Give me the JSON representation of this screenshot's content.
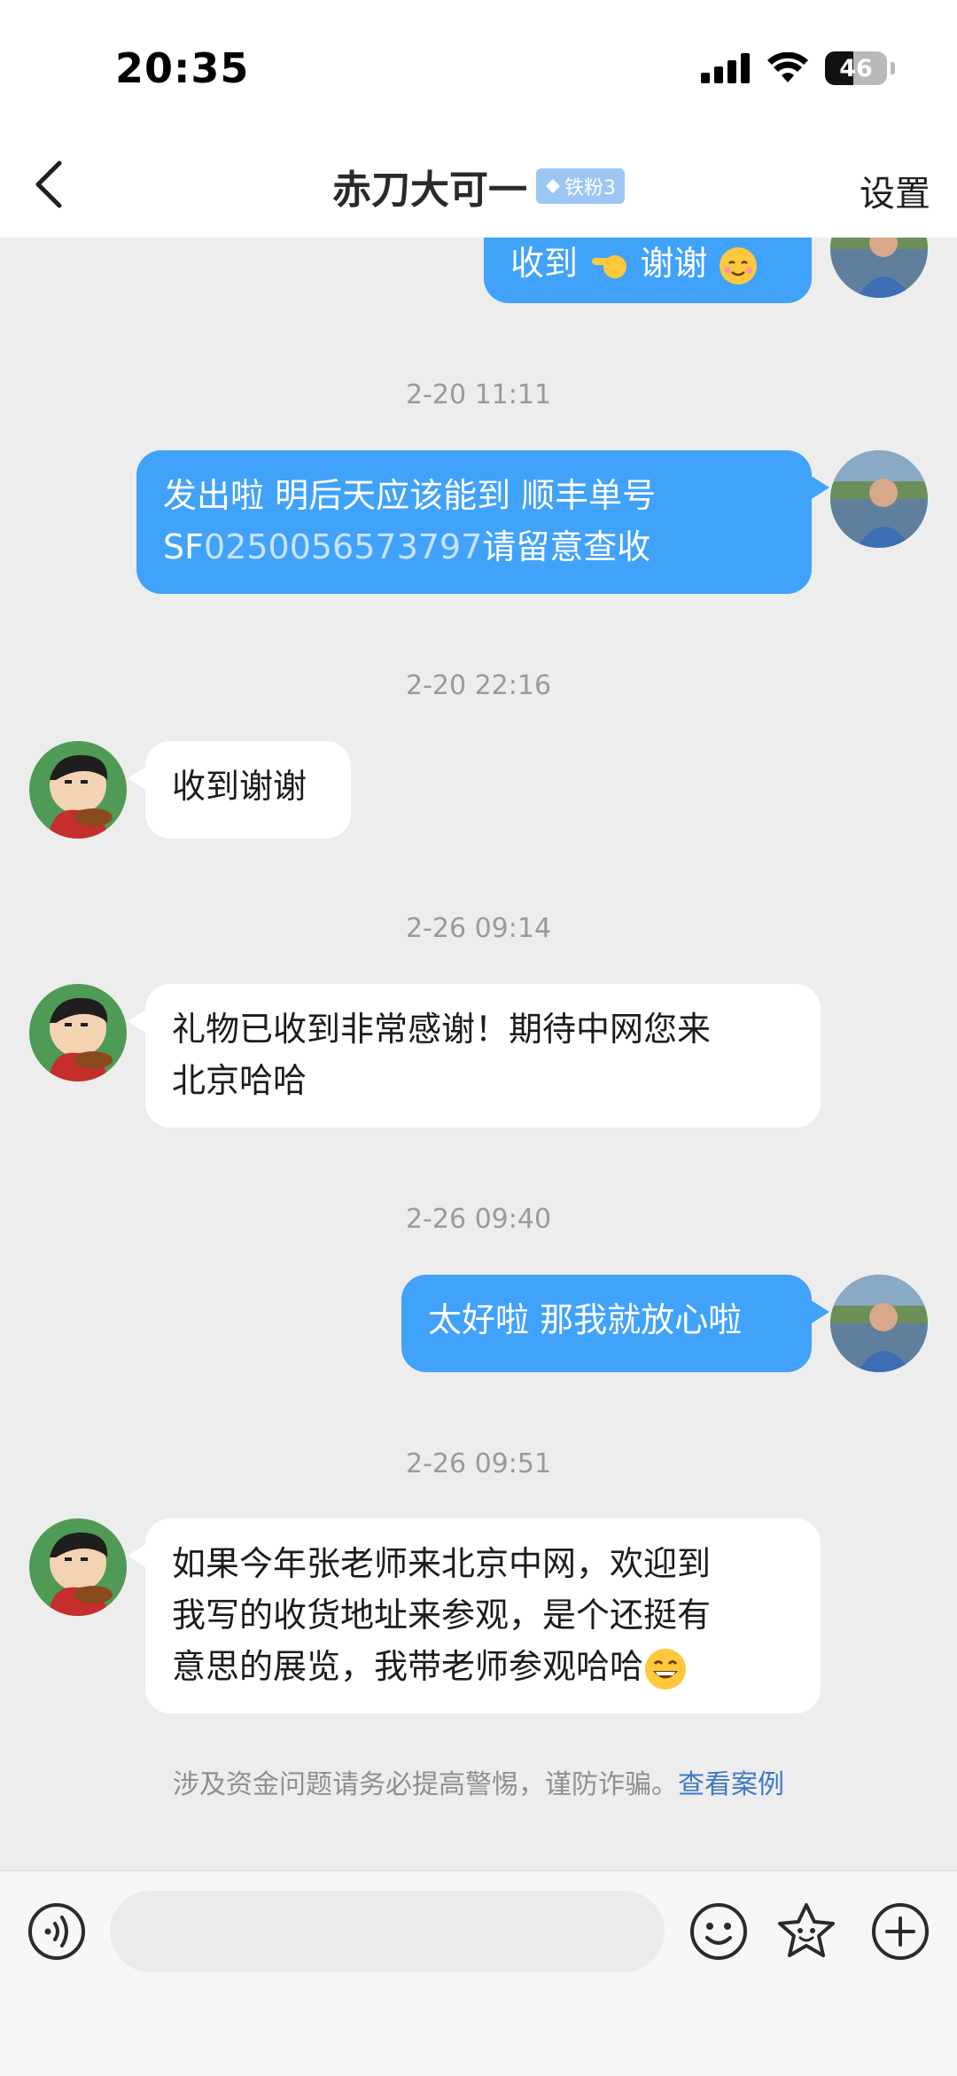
{
  "status_bar": {
    "time": "20:35",
    "battery_level": "46",
    "battery_fraction": 0.46
  },
  "header": {
    "title": "赤刀大可一",
    "fan_badge": "铁粉3",
    "settings_label": "设置"
  },
  "messages": [
    {
      "type": "sent",
      "text": "收到",
      "text_after": "谢谢",
      "partial": true
    },
    {
      "type": "time",
      "text": "2-20 11:11"
    },
    {
      "type": "sent",
      "line1": "发出啦 明后天应该能到 顺丰单号",
      "line2_prefix": "SF",
      "tracking": "0250056573797",
      "line2_suffix": "请留意查收"
    },
    {
      "type": "time",
      "text": "2-20 22:16"
    },
    {
      "type": "received",
      "text": "收到谢谢"
    },
    {
      "type": "time",
      "text": "2-26 09:14"
    },
    {
      "type": "received",
      "line1": "礼物已收到非常感谢！期待中网您来",
      "line2": "北京哈哈"
    },
    {
      "type": "time",
      "text": "2-26 09:40"
    },
    {
      "type": "sent",
      "text": "太好啦 那我就放心啦"
    },
    {
      "type": "time",
      "text": "2-26 09:51"
    },
    {
      "type": "received",
      "line1": "如果今年张老师来北京中网，欢迎到",
      "line2": "我写的收货地址来参观，是个还挺有",
      "line3": "意思的展览，我带老师参观哈哈"
    }
  ],
  "warning": {
    "text": "涉及资金问题请务必提高警惕，谨防诈骗。",
    "link": "查看案例"
  },
  "input": {
    "placeholder": ""
  },
  "icons": {
    "voice": "voice-icon",
    "emoji": "emoji-icon",
    "sticker": "sticker-icon",
    "add": "add-icon"
  },
  "colors": {
    "sent_bubble": "#41a2fa",
    "received_bubble": "#ffffff",
    "background": "#ededed",
    "link": "#3f78c3"
  }
}
